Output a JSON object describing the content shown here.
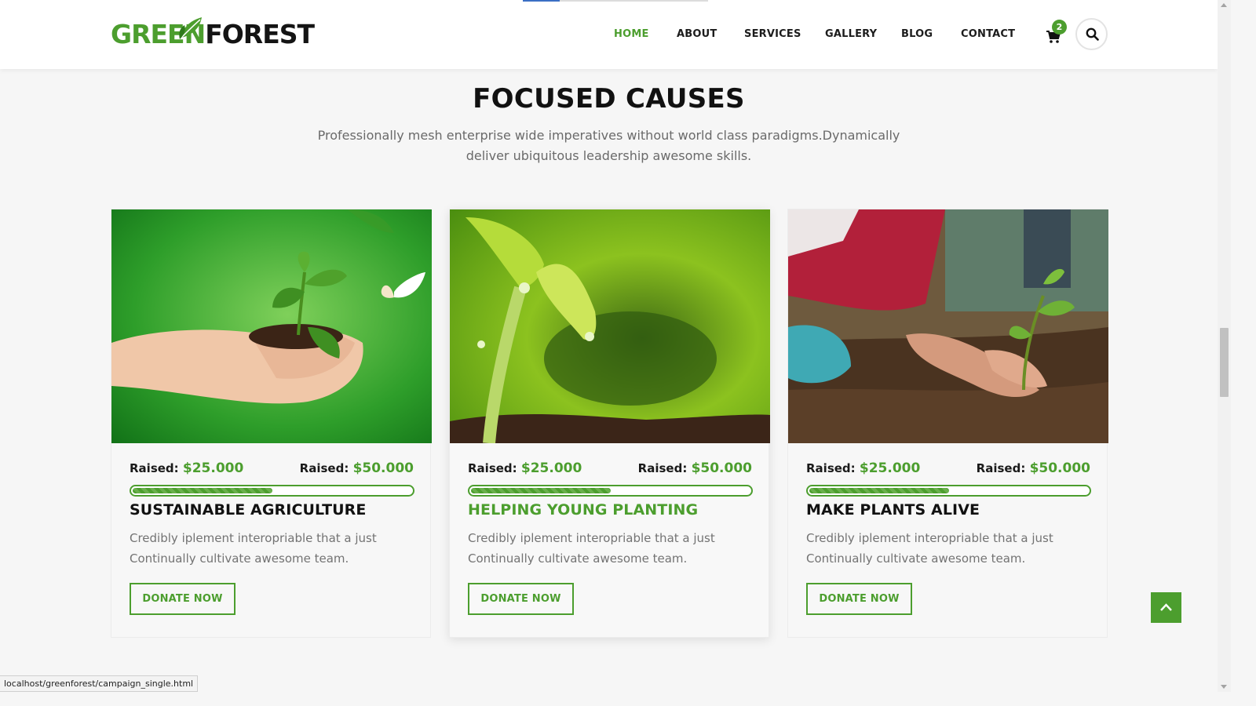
{
  "brand": {
    "part1": "GREEN",
    "part2": "FOREST",
    "accent": "#4c9e2e"
  },
  "nav": {
    "items": [
      "HOME",
      "ABOUT",
      "SERVICES",
      "GALLERY",
      "BLOG",
      "CONTACT"
    ],
    "active": "HOME",
    "cart_count": "2",
    "icons": [
      "shopping-cart-icon",
      "search-icon"
    ]
  },
  "section": {
    "title": "FOCUSED CAUSES",
    "subtitle": "Professionally mesh enterprise wide imperatives without world class paradigms.Dynamically deliver ubiquitous leadership awesome skills."
  },
  "causes": [
    {
      "title": "SUSTAINABLE AGRICULTURE",
      "raised_label": "Raised:",
      "raised": "$25.000",
      "goal_label": "Raised:",
      "goal": "$50.000",
      "progress": 0.5,
      "description": "Credibly iplement interopriable that a just Continually cultivate awesome team.",
      "button": "DONATE NOW",
      "image": "hands-holding-seedling-photo"
    },
    {
      "title": "HELPING YOUNG PLANTING",
      "raised_label": "Raised:",
      "raised": "$25.000",
      "goal_label": "Raised:",
      "goal": "$50.000",
      "progress": 0.5,
      "description": "Credibly iplement interopriable that a just Continually cultivate awesome team.",
      "button": "DONATE NOW",
      "image": "sprout-with-dew-photo"
    },
    {
      "title": "MAKE PLANTS ALIVE",
      "raised_label": "Raised:",
      "raised": "$25.000",
      "goal_label": "Raised:",
      "goal": "$50.000",
      "progress": 0.5,
      "description": "Credibly iplement interopriable that a just Continually cultivate awesome team.",
      "button": "DONATE NOW",
      "image": "child-planting-tree-photo"
    }
  ],
  "status_bar": {
    "url": "localhost/greenforest/campaign_single.html"
  },
  "icons": {
    "back_to_top": "chevron-up-icon"
  }
}
